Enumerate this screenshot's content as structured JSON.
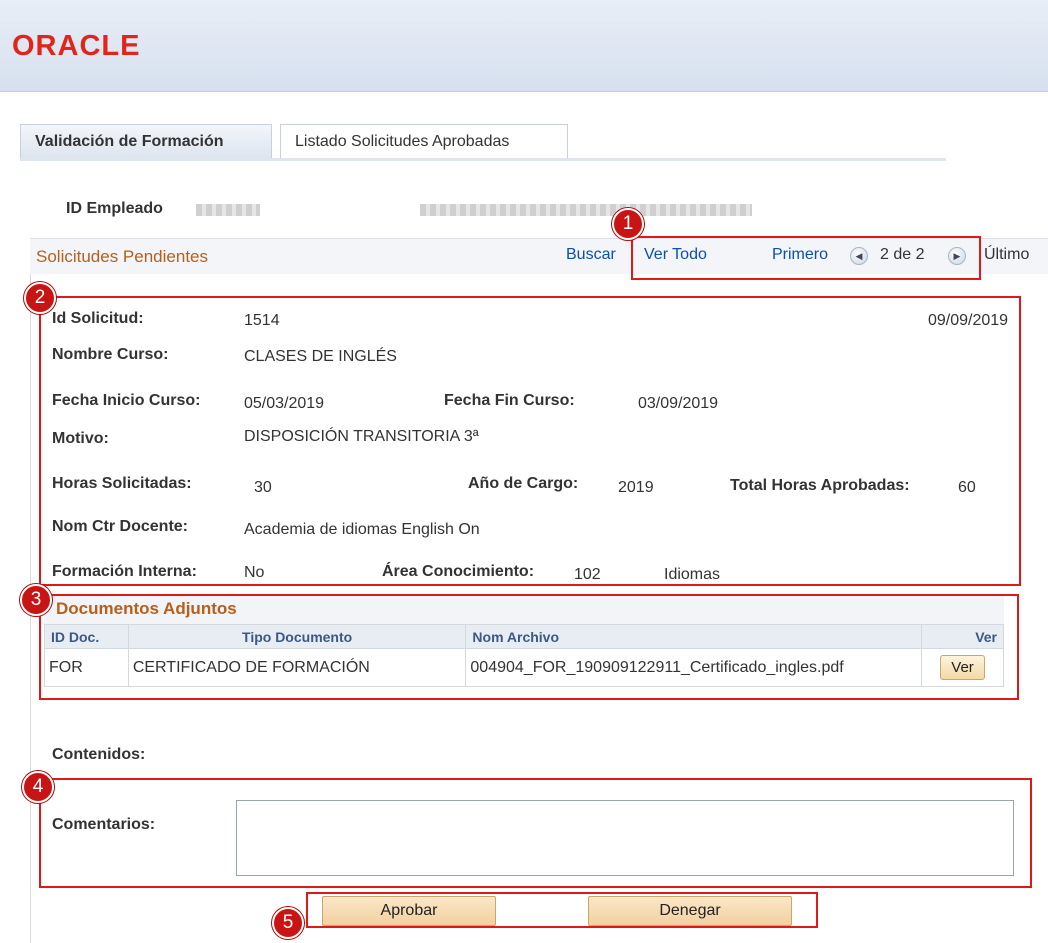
{
  "header": {
    "logo": "ORACLE"
  },
  "tabs": [
    {
      "label": "Validación de Formación",
      "active": true
    },
    {
      "label": "Listado Solicitudes Aprobadas",
      "active": false
    }
  ],
  "employee": {
    "id_label": "ID Empleado"
  },
  "section": {
    "title": "Solicitudes Pendientes",
    "nav": {
      "buscar": "Buscar",
      "ver_todo": "Ver Todo",
      "primero": "Primero",
      "position": "2 de 2",
      "ultimo": "Último"
    }
  },
  "request": {
    "id_label": "Id Solicitud:",
    "id_value": "1514",
    "date": "09/09/2019",
    "course_label": "Nombre Curso:",
    "course_value": "CLASES DE INGLÉS",
    "start_label": "Fecha Inicio Curso:",
    "start_value": "05/03/2019",
    "end_label": "Fecha Fin Curso:",
    "end_value": "03/09/2019",
    "reason_label": "Motivo:",
    "reason_value": "DISPOSICIÓN TRANSITORIA 3ª",
    "hours_label": "Horas Solicitadas:",
    "hours_value": "30",
    "year_label": "Año de Cargo:",
    "year_value": "2019",
    "total_label": "Total Horas Aprobadas:",
    "total_value": "60",
    "center_label": "Nom Ctr Docente:",
    "center_value": "Academia de idiomas English On",
    "internal_label": "Formación Interna:",
    "internal_value": "No",
    "area_label": "Área Conocimiento:",
    "area_code": "102",
    "area_name": "Idiomas"
  },
  "documents": {
    "title": "Documentos Adjuntos",
    "columns": [
      "ID Doc.",
      "Tipo Documento",
      "Nom Archivo",
      "Ver"
    ],
    "rows": [
      {
        "id": "FOR",
        "type": "CERTIFICADO DE FORMACIÓN",
        "file": "004904_FOR_190909122911_Certificado_ingles.pdf",
        "button": "Ver"
      }
    ]
  },
  "contents_label": "Contenidos:",
  "comments_label": "Comentarios:",
  "actions": {
    "approve": "Aprobar",
    "deny": "Denegar"
  },
  "badges": [
    "1",
    "2",
    "3",
    "4",
    "5"
  ],
  "colors": {
    "accent_red": "#e01818",
    "link_blue": "#0b4fae",
    "section_orange": "#b95e18",
    "logo_red": "#e0261b"
  }
}
